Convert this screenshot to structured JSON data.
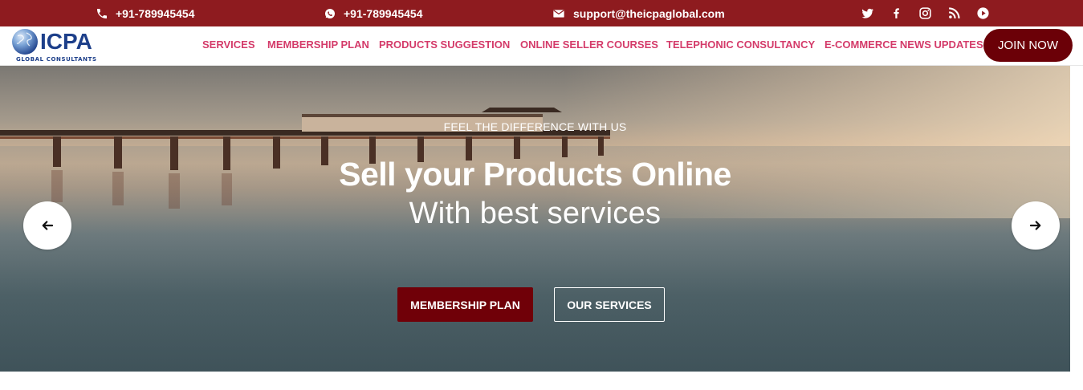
{
  "topbar": {
    "phone": "+91-789945454",
    "whatsapp": "+91-789945454",
    "email": "support@theicpaglobal.com",
    "social_icons": [
      "twitter-icon",
      "facebook-icon",
      "instagram-icon",
      "rss-icon",
      "youtube-icon"
    ]
  },
  "header": {
    "logo_text": "ICPA",
    "logo_subtext": "GLOBAL CONSULTANTS",
    "nav": [
      {
        "label": "SERVICES"
      },
      {
        "label": "MEMBERSHIP PLAN"
      },
      {
        "label": "PRODUCTS SUGGESTION"
      },
      {
        "label": "ONLINE SELLER COURSES"
      },
      {
        "label": "TELEPHONIC CONSULTANCY"
      },
      {
        "label": "E-COMMERCE NEWS UPDATES"
      }
    ],
    "join_label": "JOIN NOW"
  },
  "hero": {
    "eyebrow": "FEEL THE DIFFERENCE WITH US",
    "headline": "Sell your Products Online",
    "subheadline": "With best services",
    "primary_button": "MEMBERSHIP PLAN",
    "secondary_button": "OUR SERVICES",
    "prev_icon": "arrow-left-icon",
    "next_icon": "arrow-right-icon"
  },
  "colors": {
    "topbar_bg": "#8e1b1f",
    "nav_text": "#d43b6a",
    "brand_blue": "#1d3f8a",
    "button_dark_red": "#700008"
  }
}
